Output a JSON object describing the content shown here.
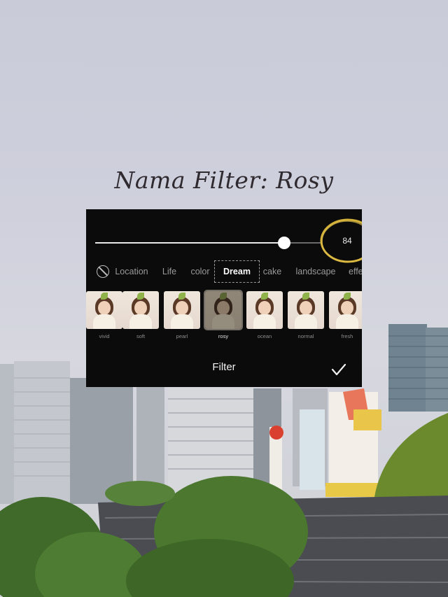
{
  "caption": "Nama Filter: Rosy",
  "slider": {
    "value_label": "84",
    "level": 0.84
  },
  "tabs": [
    {
      "label": "Location",
      "active": false
    },
    {
      "label": "Life",
      "active": false
    },
    {
      "label": "color",
      "active": false
    },
    {
      "label": "Dream",
      "active": true
    },
    {
      "label": "cake",
      "active": false
    },
    {
      "label": "landscape",
      "active": false
    },
    {
      "label": "effe",
      "active": false
    }
  ],
  "filters": [
    {
      "label": "vivid",
      "selected": false
    },
    {
      "label": "soft",
      "selected": false
    },
    {
      "label": "pearl",
      "selected": false
    },
    {
      "label": "rosy",
      "selected": true
    },
    {
      "label": "ocean",
      "selected": false
    },
    {
      "label": "normal",
      "selected": false
    },
    {
      "label": "fresh",
      "selected": false
    }
  ],
  "bottom_bar": {
    "title": "Filter"
  },
  "icons": {
    "no_filter": "no-filter-icon",
    "confirm": "checkmark-icon"
  },
  "colors": {
    "panel": "#0b0b0b",
    "accent_ring": "#d4b23a"
  }
}
